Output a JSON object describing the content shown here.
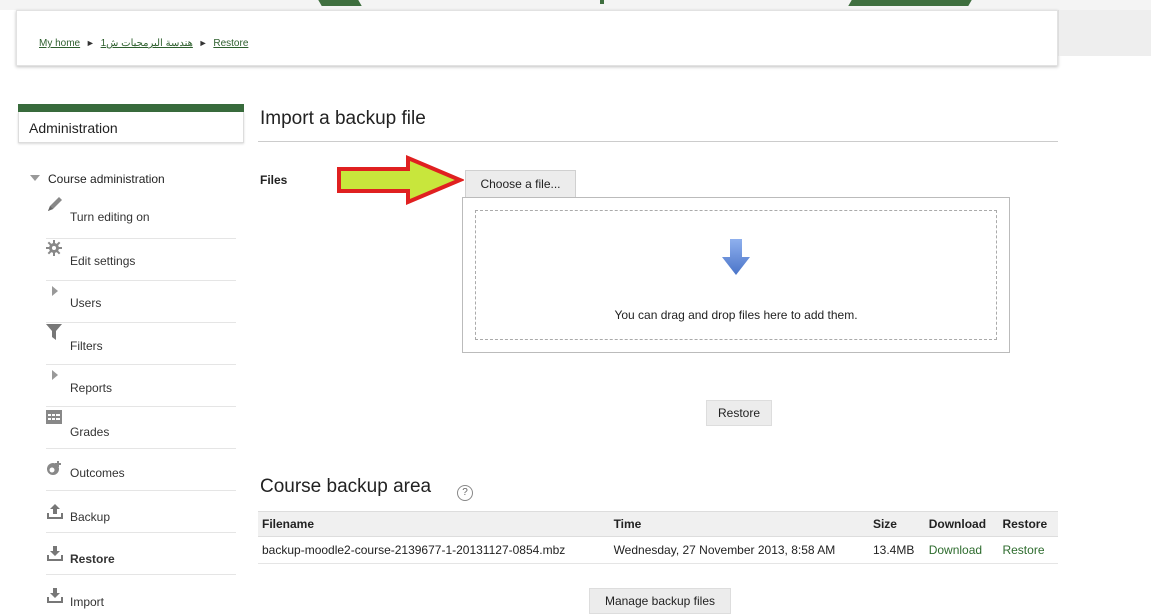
{
  "breadcrumb": {
    "home": "My home",
    "course": "هندسة البرمجيات ش1",
    "current": "Restore",
    "separator": "►"
  },
  "sidebar": {
    "title": "Administration",
    "section": "Course administration",
    "items": [
      {
        "label": "Turn editing on",
        "icon": "pencil-icon"
      },
      {
        "label": "Edit settings",
        "icon": "gear-icon"
      },
      {
        "label": "Users",
        "icon": "expand-arrow-icon"
      },
      {
        "label": "Filters",
        "icon": "funnel-icon"
      },
      {
        "label": "Reports",
        "icon": "expand-arrow-icon"
      },
      {
        "label": "Grades",
        "icon": "grades-table-icon"
      },
      {
        "label": "Outcomes",
        "icon": "outcomes-icon"
      },
      {
        "label": "Backup",
        "icon": "upload-icon"
      },
      {
        "label": "Restore",
        "icon": "download-icon"
      },
      {
        "label": "Import",
        "icon": "download-icon"
      }
    ]
  },
  "main": {
    "title": "Import a backup file",
    "files_label": "Files",
    "choose_button": "Choose a file...",
    "dropzone_text": "You can drag and drop files here to add them.",
    "restore_button": "Restore"
  },
  "backup_area": {
    "title": "Course backup area",
    "help": "?",
    "columns": [
      "Filename",
      "Time",
      "Size",
      "Download",
      "Restore"
    ],
    "rows": [
      {
        "filename": "backup-moodle2-course-2139677-1-20131127-0854.mbz",
        "time": "Wednesday, 27 November 2013, 8:58 AM",
        "size": "13.4MB",
        "download": "Download",
        "restore": "Restore"
      }
    ],
    "manage_button": "Manage backup files"
  },
  "colors": {
    "brand_green": "#386b3c",
    "link_green": "#2d6b2d",
    "callout_fill": "#c8e63c",
    "callout_stroke": "#e02020",
    "dropzone_arrow": "#5b86d6"
  }
}
